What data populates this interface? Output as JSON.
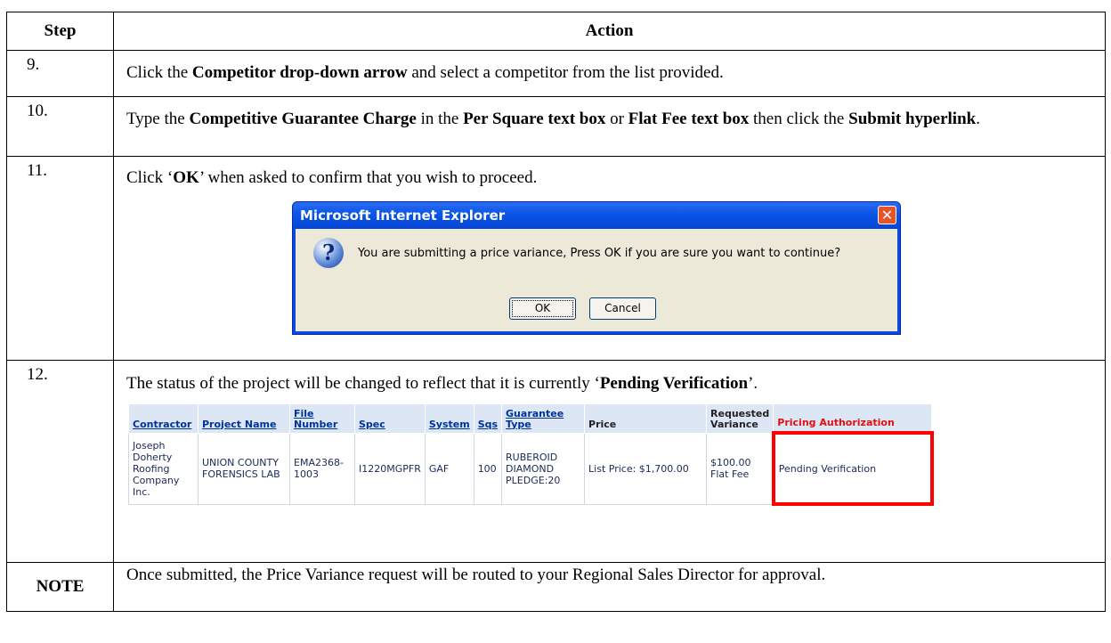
{
  "headers": {
    "step": "Step",
    "action": "Action"
  },
  "steps": {
    "s9": {
      "num": "9.",
      "parts": [
        {
          "text": "Click the ",
          "bold": false
        },
        {
          "text": "Competitor drop-down arrow",
          "bold": true
        },
        {
          "text": " and select a competitor from the list provided.",
          "bold": false
        }
      ]
    },
    "s10": {
      "num": "10.",
      "parts": [
        {
          "text": "Type the ",
          "bold": false
        },
        {
          "text": "Competitive Guarantee Charge",
          "bold": true
        },
        {
          "text": " in the ",
          "bold": false
        },
        {
          "text": "Per Square text box",
          "bold": true
        },
        {
          "text": " or ",
          "bold": false
        },
        {
          "text": "Flat Fee text box",
          "bold": true
        },
        {
          "text": " then click the ",
          "bold": false
        },
        {
          "text": "Submit hyperlink",
          "bold": true
        },
        {
          "text": ".",
          "bold": false
        }
      ]
    },
    "s11": {
      "num": "11.",
      "parts": [
        {
          "text": "Click ‘",
          "bold": false
        },
        {
          "text": "OK",
          "bold": true
        },
        {
          "text": "’ when asked to confirm that you wish to proceed.",
          "bold": false
        }
      ]
    },
    "s12": {
      "num": "12.",
      "parts": [
        {
          "text": "The status of the project will be changed to reflect that it is currently ‘",
          "bold": false
        },
        {
          "text": "Pending Verification",
          "bold": true
        },
        {
          "text": "’.",
          "bold": false
        }
      ]
    }
  },
  "dialog": {
    "title": "Microsoft Internet Explorer",
    "close_icon": "close-icon",
    "question_icon": "question-icon",
    "question_glyph": "?",
    "message": "You are submitting a price variance, Press OK if you are sure you want to continue?",
    "ok_label": "OK",
    "cancel_label": "Cancel"
  },
  "grid": {
    "headers": {
      "contractor": "Contractor",
      "project_name": "Project Name",
      "file_number": "File Number",
      "spec": "Spec",
      "system": "System",
      "sqs": "Sqs",
      "guarantee_type": "Guarantee Type",
      "price": "Price",
      "requested_variance": "Requested Variance",
      "pricing_authorization": "Pricing Authorization"
    },
    "row": {
      "contractor": "Joseph Doherty Roofing Company Inc.",
      "project_name": "UNION COUNTY FORENSICS LAB",
      "file_number": "EMA2368-1003",
      "spec": "I1220MGPFR",
      "system": "GAF",
      "sqs": "100",
      "guarantee_type": "RUBEROID DIAMOND PLEDGE:20",
      "price": "List Price: $1,700.00",
      "requested_variance": "$100.00 Flat Fee",
      "pricing_authorization": "Pending Verification"
    }
  },
  "note": {
    "label": "NOTE",
    "text": "Once submitted, the Price Variance request will be routed to your Regional Sales Director for approval."
  },
  "colors": {
    "dialog_frame": "#0a4ae0",
    "dialog_body": "#ece9d8",
    "highlight_border": "#ff0000",
    "grid_header_bg": "#dde6f4",
    "link_blue": "#003399",
    "auth_header_red": "#dd1111"
  }
}
